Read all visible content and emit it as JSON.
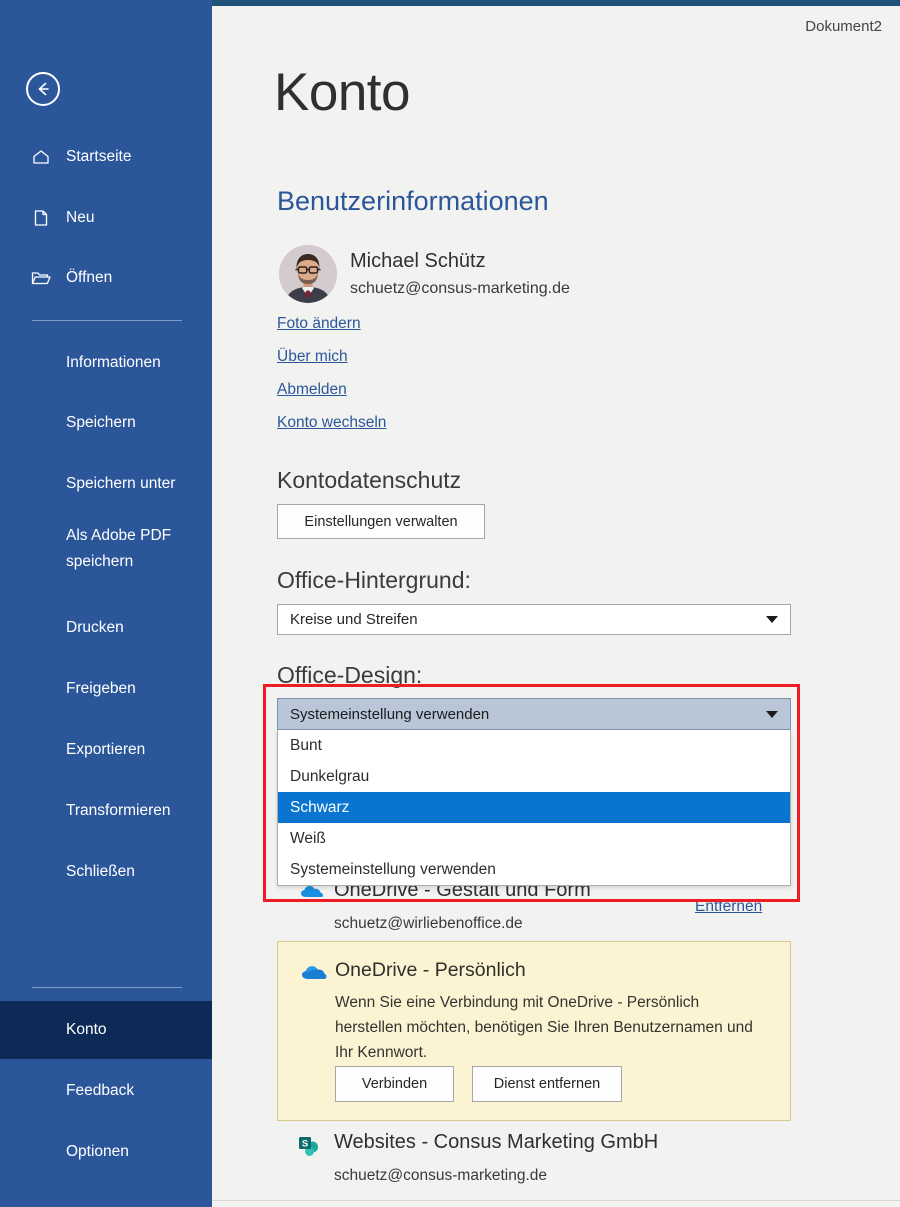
{
  "window": {
    "document_name": "Dokument2",
    "page_title": "Konto",
    "accent_color": "#2b579a",
    "top_strip_color": "#205178",
    "highlight_box_color": "#ee1c25",
    "selected_option_color": "#0a75d0"
  },
  "sidebar": {
    "back_button": "back-arrow",
    "top_items": [
      {
        "label": "Startseite",
        "icon": "home-icon"
      },
      {
        "label": "Neu",
        "icon": "new-document-icon"
      },
      {
        "label": "Öffnen",
        "icon": "open-folder-icon"
      }
    ],
    "mid_items": [
      {
        "label": "Informationen"
      },
      {
        "label": "Speichern"
      },
      {
        "label": "Speichern unter"
      },
      {
        "label": "Als Adobe PDF\nspeichern"
      },
      {
        "label": "Drucken"
      },
      {
        "label": "Freigeben"
      },
      {
        "label": "Exportieren"
      },
      {
        "label": "Transformieren"
      },
      {
        "label": "Schließen"
      }
    ],
    "bottom_items": [
      {
        "label": "Konto",
        "selected": true
      },
      {
        "label": "Feedback",
        "selected": false
      },
      {
        "label": "Optionen",
        "selected": false
      }
    ]
  },
  "main": {
    "user_section": {
      "heading": "Benutzerinformationen",
      "user_name": "Michael Schütz",
      "user_email": "schuetz@consus-marketing.de",
      "avatar": "user-photo-avatar",
      "links": [
        "Foto ändern",
        "Über mich",
        "Abmelden",
        "Konto wechseln"
      ]
    },
    "privacy_section": {
      "heading": "Kontodatenschutz",
      "button_label": "Einstellungen verwalten"
    },
    "background_section": {
      "heading": "Office-Hintergrund:",
      "selected_value": "Kreise und Streifen"
    },
    "theme_section": {
      "heading": "Office-Design:",
      "selected_value": "Systemeinstellung verwenden",
      "options": [
        {
          "label": "Bunt",
          "highlighted": false
        },
        {
          "label": "Dunkelgrau",
          "highlighted": false
        },
        {
          "label": "Schwarz",
          "highlighted": true
        },
        {
          "label": "Weiß",
          "highlighted": false
        },
        {
          "label": "Systemeinstellung verwenden",
          "highlighted": false
        }
      ]
    },
    "services": [
      {
        "title": "OneDrive - Gestalt und Form",
        "email": "schuetz@wirliebenoffice.de",
        "icon": "onedrive-business-icon",
        "remove_link": "Entfernen"
      },
      {
        "title": "OneDrive - Persönlich",
        "icon": "onedrive-cloud-icon",
        "description": "Wenn Sie eine Verbindung mit OneDrive - Persönlich herstellen möchten, benötigen Sie Ihren Benutzernamen und Ihr Kennwort.",
        "buttons": [
          "Verbinden",
          "Dienst entfernen"
        ]
      },
      {
        "title": "Websites - Consus Marketing GmbH",
        "email": "schuetz@consus-marketing.de",
        "icon": "sharepoint-icon"
      }
    ]
  }
}
